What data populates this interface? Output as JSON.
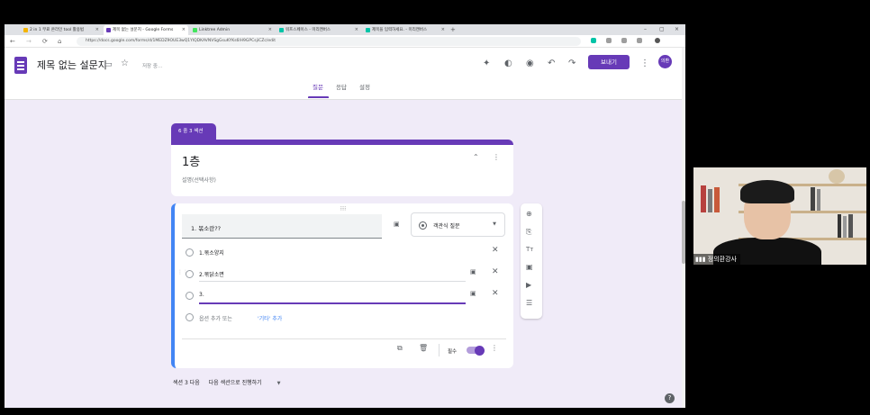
{
  "browser": {
    "tabs": [
      {
        "label": "2 in 1 무료 온라인 tool 활용법",
        "color": "#f4b400"
      },
      {
        "label": "제목 없는 설문지 - Google Forms",
        "color": "#673ab7",
        "active": true
      },
      {
        "label": "Linktree Admin",
        "color": "#43e55e"
      },
      {
        "label": "워프스페이스 - 미리캔버스",
        "color": "#00c4a7"
      },
      {
        "label": "제목을 입력하세요. - 미리캔버스",
        "color": "#00c4a7"
      }
    ],
    "tab_close": "×",
    "new_tab": "+",
    "window_controls": {
      "minimize": "–",
      "maximize": "▢",
      "close": "×"
    },
    "nav": {
      "back": "←",
      "forward": "→",
      "reload": "⟳",
      "home": "⌂"
    },
    "url": "https://docs.google.com/forms/d/1MEDZ9OUE3wQ1YlQDKAVNVSgGsuKYKs6lH9GPCsjiCZc/edit"
  },
  "header": {
    "title": "제목 없는 설문지",
    "saving": "저장 중...",
    "send_label": "보내기",
    "avatar": "의환",
    "icons": {
      "folder": "▭",
      "star": "☆",
      "addon": "✦",
      "palette": "◐",
      "preview": "◉",
      "undo": "↶",
      "redo": "↷",
      "more": "⋮"
    },
    "tabs": [
      "질문",
      "응답",
      "설정"
    ]
  },
  "section": {
    "badge": "6 중 3 섹션",
    "title": "1층",
    "description": "설명(선택사항)",
    "collapse_icon": "⌃",
    "more_icon": "⋮"
  },
  "question": {
    "drag": "⠿⠿",
    "title": "1. 볶소란??",
    "image_icon": "▣",
    "type_label": "객관식 질문",
    "type_caret": "▼",
    "options": [
      "1.볶소양지",
      "2.볶닭소면",
      "3."
    ],
    "option_close": "✕",
    "option_grip": "⋮⋮",
    "add_option": "옵션 추가 또는",
    "add_other": "'기타' 추가",
    "required_label": "필수",
    "required": true,
    "footer_icons": {
      "copy": "⧉",
      "delete": "🗑",
      "more": "⋮"
    }
  },
  "toolbox": {
    "icons": [
      "⊕",
      "⎘",
      "Tт",
      "▣",
      "▶",
      "☰"
    ]
  },
  "after_section": {
    "label": "섹션 3 다음",
    "value": "다음 섹션으로 진행하기",
    "caret": "▼"
  },
  "help": "?",
  "webcam": {
    "name": "정의환강사"
  }
}
